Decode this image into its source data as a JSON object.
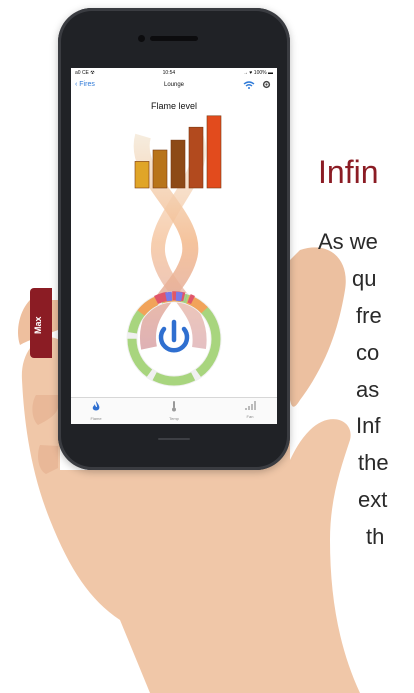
{
  "marketing": {
    "heading": "Infin",
    "lines": [
      "As we",
      "qu",
      "fre",
      "co",
      "as",
      "Inf",
      "the",
      "ext",
      "th"
    ]
  },
  "status_bar": {
    "carrier": "a0 CE ☢",
    "time": "10:54",
    "battery": "→ ♥ 100% ▬"
  },
  "nav": {
    "back_label": "‹ Fires",
    "title": "Lounge"
  },
  "screen": {
    "flame_label": "Flame level",
    "max_label": "Max"
  },
  "tabs": [
    {
      "label": "Flame"
    },
    {
      "label": "Temp"
    },
    {
      "label": "Fan"
    }
  ],
  "flame_bar_levels": [
    0.35,
    0.5,
    0.63,
    0.8,
    0.95
  ],
  "colors": {
    "accent_red": "#8b1c24",
    "ios_blue": "#2f7ad8",
    "bar_gradient": [
      "#e0a528",
      "#b8741a",
      "#8d4a17",
      "#b24a1e",
      "#e24b1d"
    ]
  },
  "icons": {
    "power": "power-icon",
    "flame": "flame-icon",
    "temp": "thermometer-icon",
    "fan": "signal-icon",
    "wifi": "wifi-icon",
    "settings": "gear-icon"
  }
}
